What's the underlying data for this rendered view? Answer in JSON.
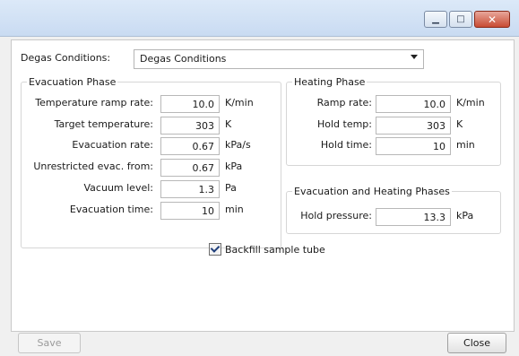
{
  "window": {
    "minimize_icon": "minimize-icon",
    "maximize_icon": "maximize-icon",
    "close_icon": "close-icon"
  },
  "degas": {
    "label": "Degas Conditions:",
    "value": "Degas Conditions"
  },
  "evac": {
    "title": "Evacuation Phase",
    "rows": [
      {
        "label": "Temperature ramp rate:",
        "value": "10.0",
        "unit": "K/min"
      },
      {
        "label": "Target temperature:",
        "value": "303",
        "unit": "K"
      },
      {
        "label": "Evacuation rate:",
        "value": "0.67",
        "unit": "kPa/s"
      },
      {
        "label": "Unrestricted evac. from:",
        "value": "0.67",
        "unit": "kPa"
      },
      {
        "label": "Vacuum level:",
        "value": "1.3",
        "unit": "Pa"
      },
      {
        "label": "Evacuation time:",
        "value": "10",
        "unit": "min"
      }
    ]
  },
  "heat": {
    "title": "Heating Phase",
    "rows": [
      {
        "label": "Ramp rate:",
        "value": "10.0",
        "unit": "K/min"
      },
      {
        "label": "Hold temp:",
        "value": "303",
        "unit": "K"
      },
      {
        "label": "Hold time:",
        "value": "10",
        "unit": "min"
      }
    ]
  },
  "both": {
    "title": "Evacuation and Heating Phases",
    "rows": [
      {
        "label": "Hold pressure:",
        "value": "13.3",
        "unit": "kPa"
      }
    ]
  },
  "backfill": {
    "label": "Backfill sample tube",
    "checked": true
  },
  "buttons": {
    "save": "Save",
    "close": "Close"
  }
}
